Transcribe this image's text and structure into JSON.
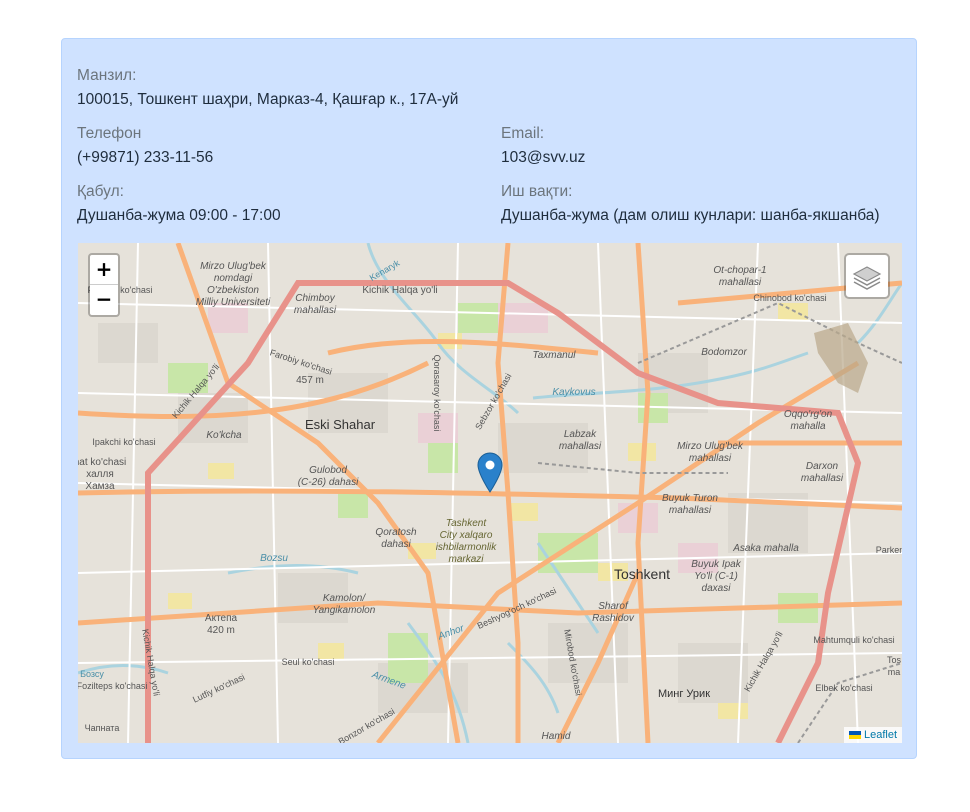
{
  "contacts": {
    "address_label": "Манзил:",
    "address_value": "100015, Тошкент шаҳри, Марказ-4, Қашғар к., 17А-уй",
    "phone_label": "Телефон",
    "phone_value": "(+99871) 233-11-56",
    "email_label": "Email:",
    "email_value": "103@svv.uz",
    "reception_label": "Қабул:",
    "reception_value": "Душанба-жума 09:00 - 17:00",
    "hours_label": "Иш вақти:",
    "hours_value": "Душанба-жума (дам олиш кунлари: шанба-якшанба)"
  },
  "map": {
    "zoom_in": "+",
    "zoom_out": "−",
    "attribution": "Leaflet",
    "colors": {
      "major_road": "#f9b27a",
      "primary_road": "#e8928a",
      "water": "#aad3df",
      "park": "#c8e6a8",
      "land": "#e8e4dc"
    },
    "labels": {
      "mirzo": [
        "Mirzo Ulug'bek",
        "nomdagi",
        "O'zbekiston",
        "Milliy Universiteti"
      ],
      "kichik_top": "Kichik Halqa yo'li",
      "chimboy": [
        "Chimboy",
        "mahallasi"
      ],
      "kenagrik": "Kenaryk",
      "otchopar": [
        "Ot-chopar-1",
        "mahallasi"
      ],
      "chinobod": "Chinobod ko'chasi",
      "farobiy": "Farobiy ko'chasi",
      "farobiy2": "Farobiy ko'chasi",
      "taxmanul": "Taxmanul",
      "bodomzor": "Bodomzor",
      "elev457": "457 m",
      "qoraqamish": "Qorasaroy ko'chasi",
      "sebzor": "Sebzor ko'chasi",
      "kaykovus": "Kaykovus",
      "oqgorgon": [
        "Oqqo'rg'on",
        "mahalla"
      ],
      "kichik_left": "Kichik Halqa yo'li",
      "ipakchi": "Ipakchi ko'chasi",
      "kokcha": "Ko'kcha",
      "eski_shahar": "Eski Shahar",
      "labzak": [
        "Labzak",
        "mahallasi"
      ],
      "mirzo_ulugbek": [
        "Mirzo Ulug'bek",
        "mahallasi"
      ],
      "darxon": [
        "Darxon",
        "mahallasi"
      ],
      "hot_kochasi": [
        "hat ko'chasi",
        "халля",
        "Хамза"
      ],
      "gulobod": [
        "Gulobod",
        "(C-26) dahasi"
      ],
      "buyuk_turon": [
        "Buyuk Turon",
        "mahallasi"
      ],
      "tashkent_city": [
        "Tashkent",
        "City xalqaro",
        "ishbilarmonlik",
        "markazi"
      ],
      "qoratosh": [
        "Qoratosh",
        "dahasi"
      ],
      "bozsu": "Bozsu",
      "asaka": "Asaka mahalla",
      "parken": "Parken",
      "toshkent": "Toshkent",
      "buyuk_ipak": [
        "Buyuk Ipak",
        "Yo'li (C-1)",
        "daxasi"
      ],
      "kamolon": [
        "Kamolon/",
        "Yangikamolon"
      ],
      "aktepa": [
        "Актепа",
        "420 m"
      ],
      "anhor": "Anhor",
      "beshyogoch": "Beshyog'och ko'chasi",
      "sharof": [
        "Sharof",
        "Rashidov"
      ],
      "mahtumquli": "Mahtumquli ko'chasi",
      "seul": "Seul ko'chasi",
      "kichik_bottom": "Kichik Halqa yo'li",
      "bozsu2": "Бозсу",
      "fozilteps": "Fozilteps ko'chasi",
      "lutfiy": "Lutfiy ko'chasi",
      "armene": "Armene",
      "mirobod": "Mirobod ko'chasi",
      "ming_urik": "Минг Урик",
      "kichik_right": "Kichik Halqa yo'li",
      "elbek": "Elbek ko'chasi",
      "tos": [
        "Tos",
        "ma"
      ],
      "chilonzor_bottom": "Чапната",
      "bonzor": "Bonzor ko'chasi",
      "hamid": "Hamid"
    }
  }
}
